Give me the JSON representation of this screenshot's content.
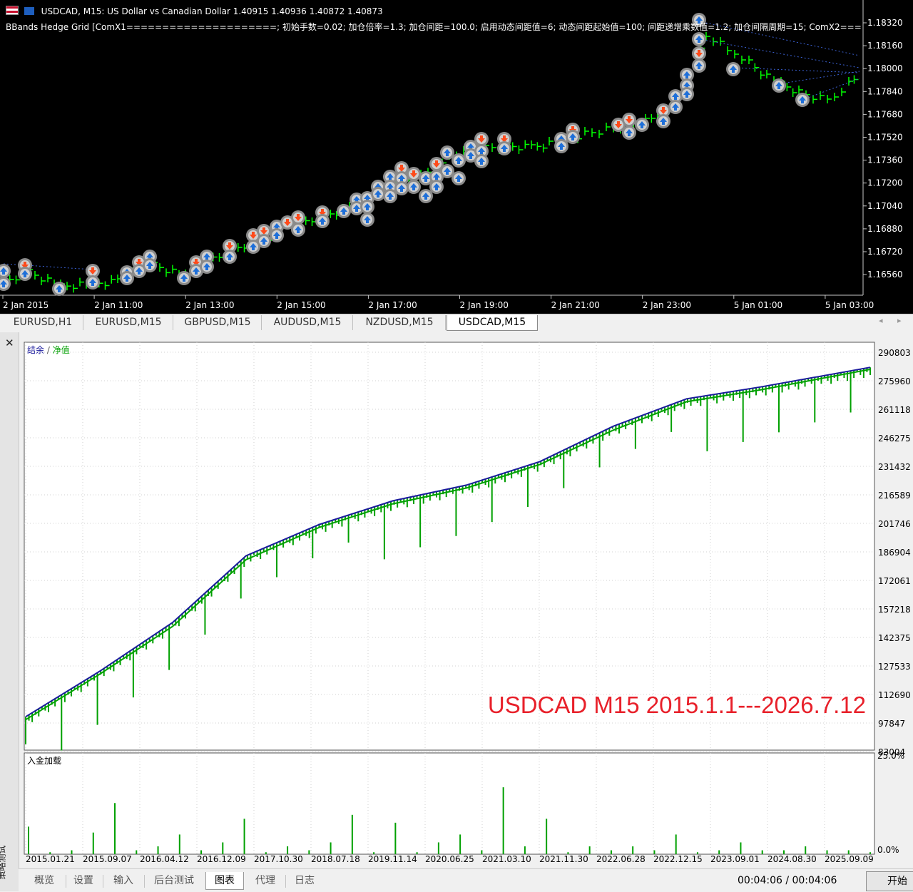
{
  "window": {
    "symbol_title": "USDCAD, M15:  US Dollar vs Canadian Dollar  1.40915 1.40936 1.40872 1.40873",
    "ea_line": "BBands Hedge Grid [ComX1=====================; 初始手数=0.02; 加仓倍率=1.3; 加仓间距=100.0; 启用动态间距值=6; 动态间距起始值=100; 间距递增乘数值=1.2; 加仓间隔周期=15; ComX2=========="
  },
  "price_axis": [
    "1.18320",
    "1.18160",
    "1.18000",
    "1.17840",
    "1.17680",
    "1.17520",
    "1.17360",
    "1.17200",
    "1.17040",
    "1.16880",
    "1.16720",
    "1.16560"
  ],
  "time_axis": [
    "2 Jan 2015",
    "2 Jan 11:00",
    "2 Jan 13:00",
    "2 Jan 15:00",
    "2 Jan 17:00",
    "2 Jan 19:00",
    "2 Jan 21:00",
    "2 Jan 23:00",
    "5 Jan 01:00",
    "5 Jan 03:00"
  ],
  "symbol_tabs": [
    "EURUSD,H1",
    "EURUSD,M15",
    "GBPUSD,M15",
    "AUDUSD,M15",
    "NZDUSD,M15",
    "USDCAD,M15"
  ],
  "active_symbol_tab": "USDCAD,M15",
  "tester": {
    "close_glyph": "✕",
    "side_label": "策略测试",
    "balance_label": "结余",
    "label_sep": " / ",
    "equity_label": "净值",
    "overlay_text": "USDCAD M15 2015.1.1---2026.7.12",
    "deposit_label": "入金加载",
    "deposit_axis": [
      "25.0%",
      "0.0%"
    ],
    "balance_axis": [
      "290803",
      "275960",
      "261118",
      "246275",
      "231432",
      "216589",
      "201746",
      "186904",
      "172061",
      "157218",
      "142375",
      "127533",
      "112690",
      "97847",
      "83004"
    ],
    "date_axis": [
      "2015.01.21",
      "2015.09.07",
      "2016.04.12",
      "2016.12.09",
      "2017.10.30",
      "2018.07.18",
      "2019.11.14",
      "2020.06.25",
      "2021.03.10",
      "2021.11.30",
      "2022.06.28",
      "2022.12.15",
      "2023.09.01",
      "2024.08.30",
      "2025.09.09"
    ]
  },
  "bottom_tabs": [
    "概览",
    "设置",
    "输入",
    "后台测试",
    "图表",
    "代理",
    "日志"
  ],
  "active_bottom_tab": "图表",
  "timer": "00:04:06 / 00:04:06",
  "start_button": "开始",
  "colors": {
    "candle": "#00ff00",
    "buy_marker": "#1e6fd9",
    "sell_marker": "#ff4a1a",
    "balance": "#1a1a9c",
    "equity": "#00a000",
    "overlay": "#e8202a"
  },
  "chart_data": [
    {
      "type": "line",
      "series": [
        {
          "name": "结余",
          "x": [
            2015.0,
            2016.0,
            2017.0,
            2018.0,
            2019.0,
            2020.0,
            2021.0,
            2022.0,
            2023.0,
            2024.0,
            2025.0,
            2026.5
          ],
          "values": [
            100000,
            123000,
            148000,
            182000,
            198000,
            210000,
            218000,
            230000,
            248000,
            262000,
            268000,
            278000
          ]
        },
        {
          "name": "净值",
          "x": [
            2015.0,
            2016.0,
            2017.0,
            2018.0,
            2019.0,
            2020.0,
            2021.0,
            2022.0,
            2023.0,
            2024.0,
            2025.0,
            2026.5
          ],
          "values": [
            98500,
            121500,
            146000,
            180000,
            196500,
            208500,
            216500,
            228500,
            246000,
            260500,
            266500,
            277000
          ]
        }
      ],
      "ylim": [
        83004,
        290803
      ],
      "grid": true
    },
    {
      "type": "bar",
      "values": [
        7,
        0.5,
        1,
        5.5,
        13,
        1,
        2,
        5,
        1,
        3,
        9,
        0.5,
        2,
        1,
        3,
        10,
        0.5,
        8,
        0.5,
        3,
        5,
        1,
        17,
        2,
        9,
        0.5,
        2,
        1,
        2,
        1,
        5,
        0.5,
        1,
        3,
        1,
        1,
        2,
        1,
        1,
        0.5
      ],
      "ylim": [
        0,
        25
      ]
    }
  ]
}
